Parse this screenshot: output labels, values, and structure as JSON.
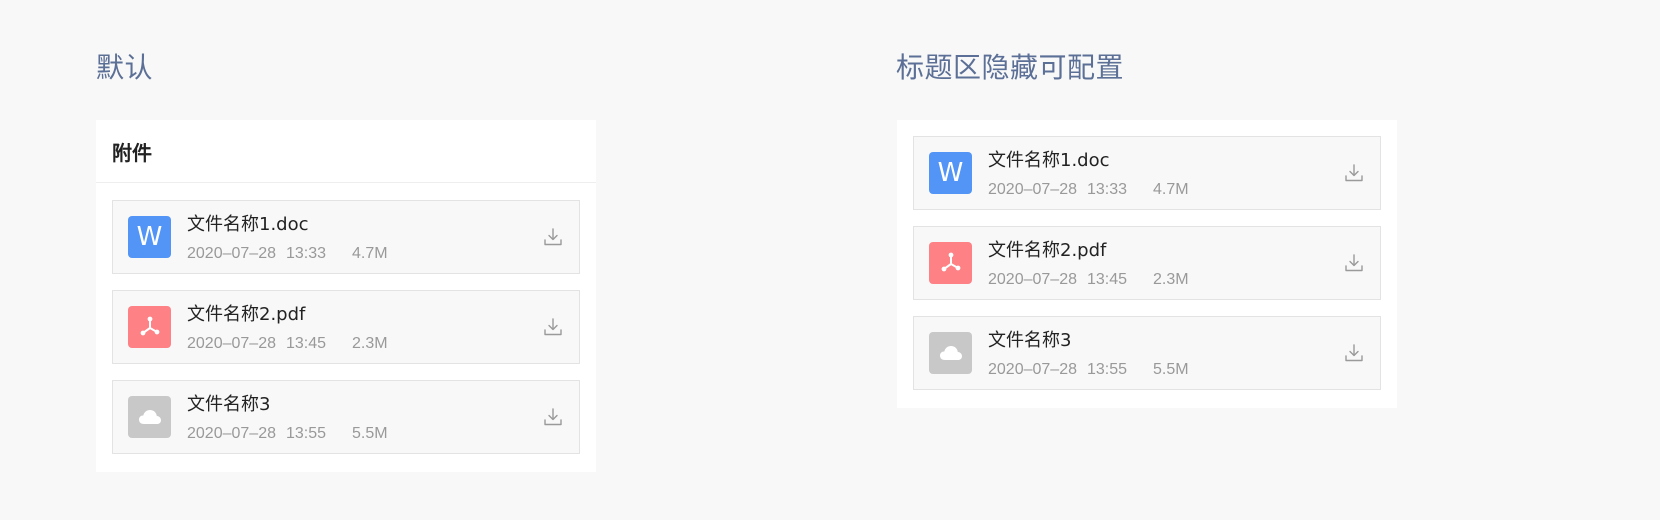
{
  "sections": {
    "default_title": "默认",
    "hidden_title": "标题区隐藏可配置"
  },
  "panel_default": {
    "header": "附件",
    "files": [
      {
        "name": "文件名称1.doc",
        "date": "2020–07–28",
        "time": "13:33",
        "size": "4.7M",
        "type": "word",
        "icon_letter": "W"
      },
      {
        "name": "文件名称2.pdf",
        "date": "2020–07–28",
        "time": "13:45",
        "size": "2.3M",
        "type": "pdf"
      },
      {
        "name": "文件名称3",
        "date": "2020–07–28",
        "time": "13:55",
        "size": "5.5M",
        "type": "cloud"
      }
    ]
  },
  "panel_hidden": {
    "files": [
      {
        "name": "文件名称1.doc",
        "date": "2020–07–28",
        "time": "13:33",
        "size": "4.7M",
        "type": "word",
        "icon_letter": "W"
      },
      {
        "name": "文件名称2.pdf",
        "date": "2020–07–28",
        "time": "13:45",
        "size": "2.3M",
        "type": "pdf"
      },
      {
        "name": "文件名称3",
        "date": "2020–07–28",
        "time": "13:55",
        "size": "5.5M",
        "type": "cloud"
      }
    ]
  },
  "colors": {
    "word": "#5295f6",
    "pdf": "#fd8185",
    "cloud": "#c8c8c8",
    "title": "#5c6f96"
  },
  "icons": {
    "word": "word-file-icon",
    "pdf": "pdf-file-icon",
    "cloud": "cloud-file-icon",
    "download": "download-icon"
  }
}
